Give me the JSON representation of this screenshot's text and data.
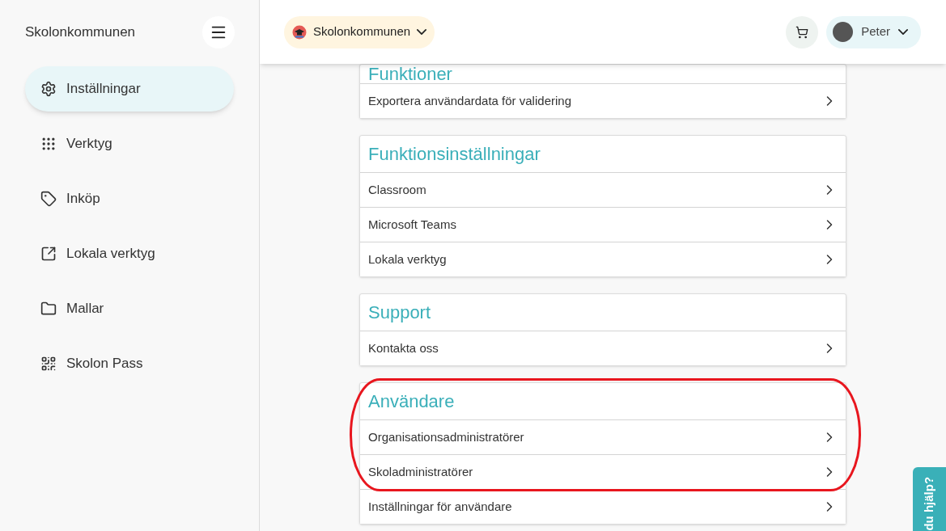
{
  "sidebar": {
    "title": "Skolonkommunen",
    "items": [
      {
        "label": "Inställningar",
        "selected": true
      },
      {
        "label": "Verktyg",
        "selected": false
      },
      {
        "label": "Inköp",
        "selected": false
      },
      {
        "label": "Lokala verktyg",
        "selected": false
      },
      {
        "label": "Mallar",
        "selected": false
      },
      {
        "label": "Skolon Pass",
        "selected": false
      }
    ]
  },
  "header": {
    "organization": "Skolonkommunen",
    "user": "Peter"
  },
  "sections": [
    {
      "title": "Funktioner",
      "items": [
        {
          "label": "Exportera användardata för validering"
        }
      ]
    },
    {
      "title": "Funktionsinställningar",
      "items": [
        {
          "label": "Classroom"
        },
        {
          "label": "Microsoft Teams"
        },
        {
          "label": "Lokala verktyg"
        }
      ]
    },
    {
      "title": "Support",
      "items": [
        {
          "label": "Kontakta oss"
        }
      ]
    },
    {
      "title": "Användare",
      "items": [
        {
          "label": "Organisationsadministratörer",
          "circled": true
        },
        {
          "label": "Skoladministratörer",
          "circled": true
        },
        {
          "label": "Inställningar för användare",
          "circled": false
        }
      ]
    }
  ],
  "help_tab": "du hjälp?"
}
